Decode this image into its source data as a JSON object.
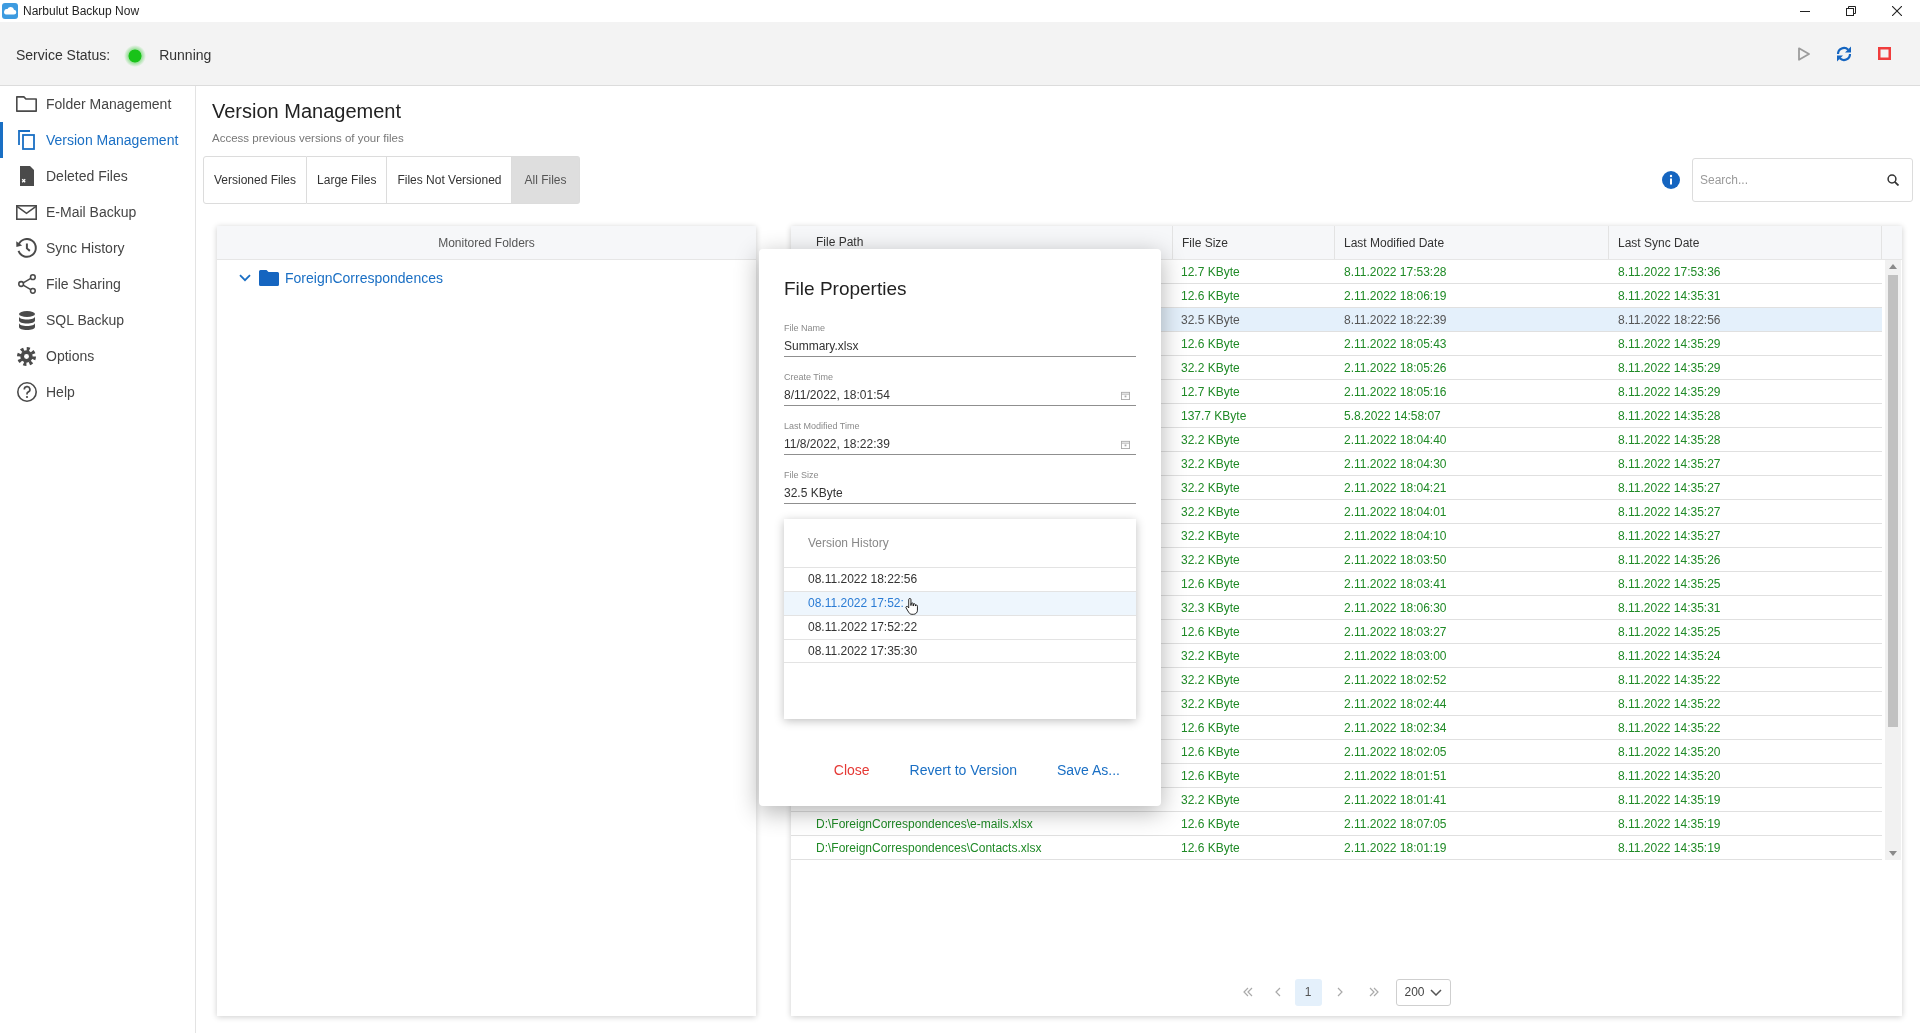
{
  "window": {
    "title": "Narbulut Backup Now"
  },
  "service": {
    "label": "Service Status:",
    "status": "Running",
    "on": true
  },
  "toolbar": [
    {
      "disabled": true
    },
    {
      "disabled": false
    },
    {
      "disabled": false
    }
  ],
  "sidebar": {
    "items": [
      {
        "label": "Folder Management",
        "selected": false
      },
      {
        "label": "Version Management",
        "selected": true
      },
      {
        "label": "Deleted Files",
        "selected": false
      },
      {
        "label": "E-Mail Backup",
        "selected": false
      },
      {
        "label": "Sync History",
        "selected": false
      },
      {
        "label": "File Sharing",
        "selected": false
      },
      {
        "label": "SQL Backup",
        "selected": false
      },
      {
        "label": "Options",
        "selected": false
      },
      {
        "label": "Help",
        "selected": false
      }
    ]
  },
  "page": {
    "title": "Version Management",
    "subtitle": "Access previous versions of your files"
  },
  "tabs": [
    {
      "label": "Versioned Files",
      "selected": false
    },
    {
      "label": "Large Files",
      "selected": false
    },
    {
      "label": "Files Not Versioned",
      "selected": false
    },
    {
      "label": "All Files",
      "selected": true
    }
  ],
  "search": {
    "placeholder": "Search..."
  },
  "folders_panel": {
    "title": "Monitored Folders",
    "tree": [
      {
        "label": "ForeignCorrespondences",
        "expanded": true
      }
    ]
  },
  "table": {
    "columns": [
      "File Path",
      "File Size",
      "Last Modified Date",
      "Last Sync Date"
    ],
    "rows": [
      {
        "file_size": "12.7 KByte",
        "last_modified": "8.11.2022 17:53:28",
        "last_sync": "8.11.2022 17:53:36",
        "selected": false
      },
      {
        "file_size": "12.6 KByte",
        "last_modified": "2.11.2022 18:06:19",
        "last_sync": "8.11.2022 14:35:31",
        "selected": false
      },
      {
        "file_size": "32.5 KByte",
        "last_modified": "8.11.2022 18:22:39",
        "last_sync": "8.11.2022 18:22:56",
        "selected": true
      },
      {
        "file_size": "12.6 KByte",
        "last_modified": "2.11.2022 18:05:43",
        "last_sync": "8.11.2022 14:35:29",
        "selected": false
      },
      {
        "file_size": "32.2 KByte",
        "last_modified": "2.11.2022 18:05:26",
        "last_sync": "8.11.2022 14:35:29",
        "selected": false
      },
      {
        "file_size": "12.7 KByte",
        "last_modified": "2.11.2022 18:05:16",
        "last_sync": "8.11.2022 14:35:29",
        "selected": false
      },
      {
        "file_size": "137.7 KByte",
        "last_modified": "5.8.2022 14:58:07",
        "last_sync": "8.11.2022 14:35:28",
        "selected": false
      },
      {
        "file_size": "32.2 KByte",
        "last_modified": "2.11.2022 18:04:40",
        "last_sync": "8.11.2022 14:35:28",
        "selected": false
      },
      {
        "file_size": "32.2 KByte",
        "last_modified": "2.11.2022 18:04:30",
        "last_sync": "8.11.2022 14:35:27",
        "selected": false
      },
      {
        "file_size": "32.2 KByte",
        "last_modified": "2.11.2022 18:04:21",
        "last_sync": "8.11.2022 14:35:27",
        "selected": false
      },
      {
        "file_size": "32.2 KByte",
        "last_modified": "2.11.2022 18:04:01",
        "last_sync": "8.11.2022 14:35:27",
        "selected": false
      },
      {
        "file_size": "32.2 KByte",
        "last_modified": "2.11.2022 18:04:10",
        "last_sync": "8.11.2022 14:35:27",
        "selected": false
      },
      {
        "file_size": "32.2 KByte",
        "last_modified": "2.11.2022 18:03:50",
        "last_sync": "8.11.2022 14:35:26",
        "selected": false
      },
      {
        "file_size": "12.6 KByte",
        "last_modified": "2.11.2022 18:03:41",
        "last_sync": "8.11.2022 14:35:25",
        "selected": false
      },
      {
        "file_size": "32.3 KByte",
        "last_modified": "2.11.2022 18:06:30",
        "last_sync": "8.11.2022 14:35:31",
        "selected": false
      },
      {
        "file_size": "12.6 KByte",
        "last_modified": "2.11.2022 18:03:27",
        "last_sync": "8.11.2022 14:35:25",
        "selected": false
      },
      {
        "file_size": "32.2 KByte",
        "last_modified": "2.11.2022 18:03:00",
        "last_sync": "8.11.2022 14:35:24",
        "selected": false
      },
      {
        "file_size": "32.2 KByte",
        "last_modified": "2.11.2022 18:02:52",
        "last_sync": "8.11.2022 14:35:22",
        "selected": false
      },
      {
        "file_size": "32.2 KByte",
        "last_modified": "2.11.2022 18:02:44",
        "last_sync": "8.11.2022 14:35:22",
        "selected": false
      },
      {
        "file_size": "12.6 KByte",
        "last_modified": "2.11.2022 18:02:34",
        "last_sync": "8.11.2022 14:35:22",
        "selected": false
      },
      {
        "file_size": "12.6 KByte",
        "last_modified": "2.11.2022 18:02:05",
        "last_sync": "8.11.2022 14:35:20",
        "selected": false
      },
      {
        "file_size": "12.6 KByte",
        "last_modified": "2.11.2022 18:01:51",
        "last_sync": "8.11.2022 14:35:20",
        "selected": false
      },
      {
        "file_size": "32.2 KByte",
        "last_modified": "2.11.2022 18:01:41",
        "last_sync": "8.11.2022 14:35:19",
        "selected": false
      },
      {
        "file_path": "D:\\ForeignCorrespondences\\e-mails.xlsx",
        "file_size": "12.6 KByte",
        "last_modified": "2.11.2022 18:07:05",
        "last_sync": "8.11.2022 14:35:19",
        "selected": false
      },
      {
        "file_path": "D:\\ForeignCorrespondences\\Contacts.xlsx",
        "file_size": "12.6 KByte",
        "last_modified": "2.11.2022 18:01:19",
        "last_sync": "8.11.2022 14:35:19",
        "selected": false
      }
    ]
  },
  "pagination": {
    "pages": [
      {
        "label": "1",
        "selected": true
      }
    ],
    "page_size": "200"
  },
  "dialog": {
    "title": "File Properties",
    "fields": [
      {
        "label": "File Name",
        "value": "Summary.xlsx",
        "kind": "text"
      },
      {
        "label": "Create Time",
        "value": "8/11/2022, 18:01:54",
        "kind": "date"
      },
      {
        "label": "Last Modified Time",
        "value": "11/8/2022, 18:22:39",
        "kind": "date"
      },
      {
        "label": "File Size",
        "value": "32.5 KByte",
        "kind": "text"
      }
    ],
    "version_history": {
      "title": "Version History",
      "items": [
        {
          "label": "08.11.2022 18:22:56",
          "selected": false
        },
        {
          "label": "08.11.2022 17:52:",
          "selected": true
        },
        {
          "label": "08.11.2022 17:52:22",
          "selected": false
        },
        {
          "label": "08.11.2022 17:35:30",
          "selected": false
        }
      ]
    },
    "buttons": [
      {
        "label": "Close",
        "kind": "danger"
      },
      {
        "label": "Revert to Version",
        "kind": "primary"
      },
      {
        "label": "Save As...",
        "kind": "primary"
      }
    ]
  }
}
